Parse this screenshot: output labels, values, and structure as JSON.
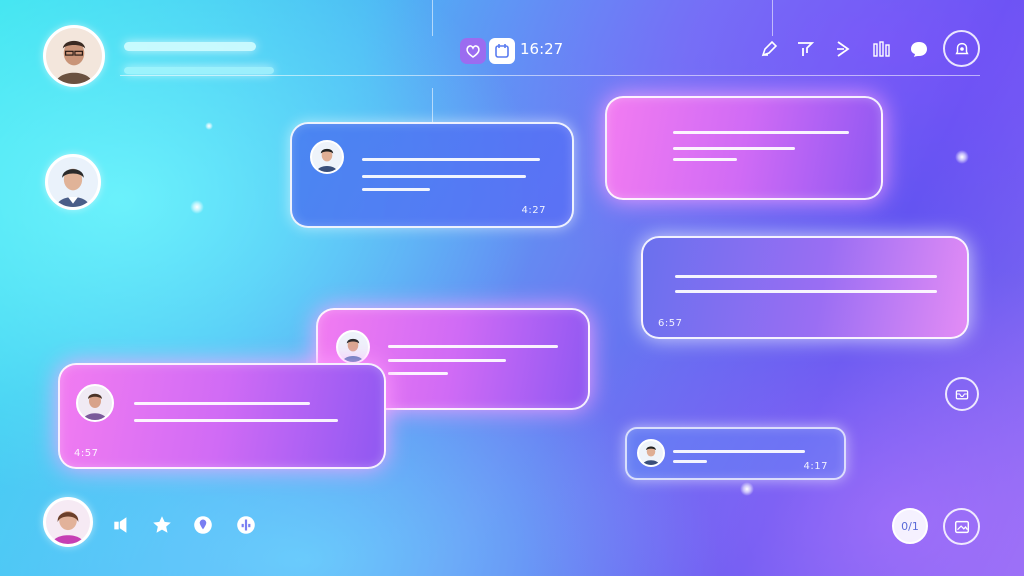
{
  "header": {
    "time": "16:27",
    "icons": [
      "heart-chat-icon",
      "calendar-icon",
      "edit-icon",
      "filter-icon",
      "forward-icon",
      "chart-bars-icon",
      "chat-bubble-icon",
      "notification-icon"
    ]
  },
  "contacts": [
    {
      "name": "contact-avatar-1"
    },
    {
      "name": "contact-avatar-2"
    }
  ],
  "messages": [
    {
      "style": "blue",
      "timestamp": "4:27"
    },
    {
      "style": "pink",
      "timestamp": ""
    },
    {
      "style": "pinkblue",
      "timestamp": "6:57"
    },
    {
      "style": "pink",
      "timestamp": ""
    },
    {
      "style": "pink",
      "timestamp": "4:57"
    },
    {
      "style": "ghost",
      "timestamp": "4:17"
    }
  ],
  "bottom_bar": {
    "icons": [
      "speaker-icon",
      "star-icon",
      "location-icon",
      "info-icon"
    ],
    "right_button_label": "0/1",
    "right_icon": "image-icon"
  },
  "side_actions": {
    "icons": [
      "inbox-icon"
    ]
  },
  "colors": {
    "accent_pink": "#f27cf1",
    "accent_blue": "#4a7af0",
    "bg_cyan": "#38e0ee"
  }
}
